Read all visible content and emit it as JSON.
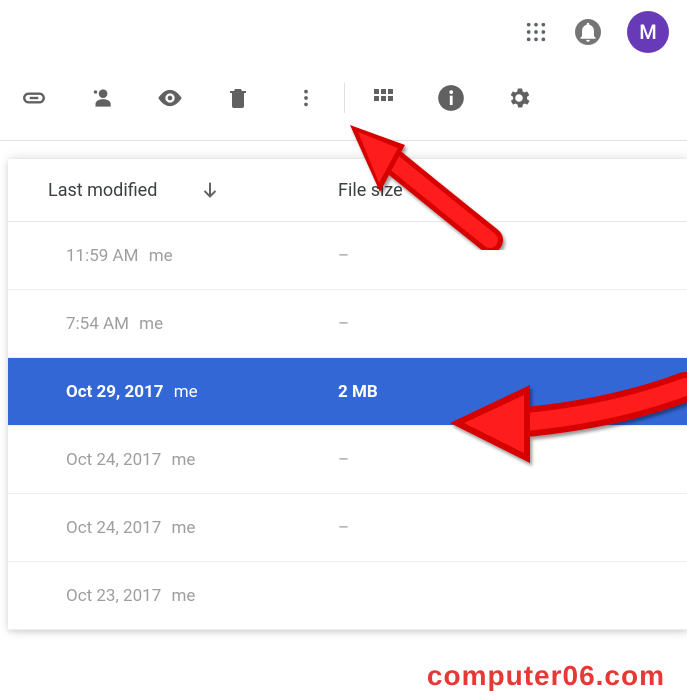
{
  "header": {
    "avatar_initial": "M"
  },
  "columns": {
    "modified_label": "Last modified",
    "size_label": "File size"
  },
  "rows": [
    {
      "date": "11:59 AM",
      "owner": "me",
      "size": "–",
      "selected": false
    },
    {
      "date": "7:54 AM",
      "owner": "me",
      "size": "–",
      "selected": false
    },
    {
      "date": "Oct 29, 2017",
      "owner": "me",
      "size": "2 MB",
      "selected": true
    },
    {
      "date": "Oct 24, 2017",
      "owner": "me",
      "size": "–",
      "selected": false
    },
    {
      "date": "Oct 24, 2017",
      "owner": "me",
      "size": "–",
      "selected": false
    },
    {
      "date": "Oct 23, 2017",
      "owner": "me",
      "size": "",
      "selected": false
    }
  ],
  "watermark": "computer06.com"
}
